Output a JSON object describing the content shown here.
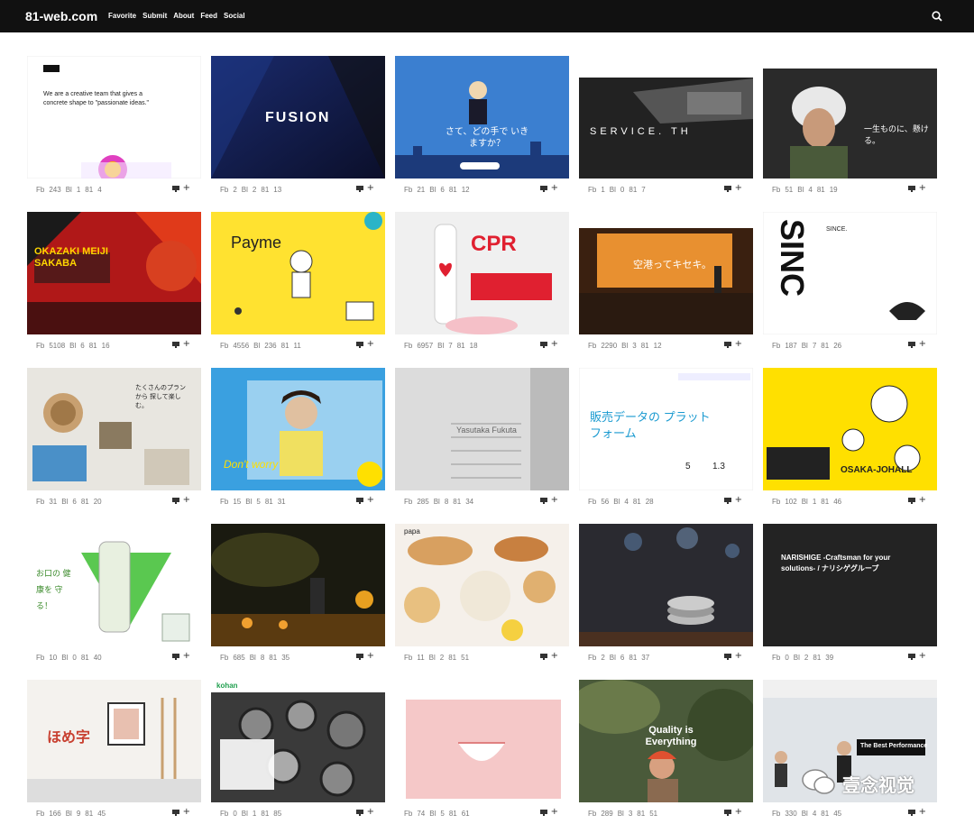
{
  "site": {
    "logo": "81-web.com"
  },
  "nav": [
    {
      "label": "Favorite"
    },
    {
      "label": "Submit"
    },
    {
      "label": "About"
    },
    {
      "label": "Feed"
    },
    {
      "label": "Social"
    }
  ],
  "watermark": "壹念视觉",
  "cards": [
    {
      "fb": "243",
      "bl": "1",
      "b1": "4",
      "text": "We are a creative team that gives a concrete shape to \"passionate ideas.\""
    },
    {
      "fb": "2",
      "bl": "2",
      "b1": "13",
      "text": "FUSION"
    },
    {
      "fb": "21",
      "bl": "6",
      "b1": "12",
      "text": "さて、どの手で いきますか？"
    },
    {
      "fb": "1",
      "bl": "0",
      "b1": "7",
      "text": "SERVICE. TH"
    },
    {
      "fb": "51",
      "bl": "4",
      "b1": "19",
      "text": "一生ものに、懸ける。"
    },
    {
      "fb": "5108",
      "bl": "6",
      "b1": "16",
      "text": "OKAZAKI MEIJI SAKABA"
    },
    {
      "fb": "4556",
      "bl": "236",
      "b1": "11",
      "text": "Payme"
    },
    {
      "fb": "6957",
      "bl": "7",
      "b1": "18",
      "text": "CPR"
    },
    {
      "fb": "2290",
      "bl": "3",
      "b1": "12",
      "text": "空港ってキセキ。"
    },
    {
      "fb": "187",
      "bl": "7",
      "b1": "26",
      "text": "SINCE."
    },
    {
      "fb": "31",
      "bl": "6",
      "b1": "20",
      "text": "たくさんのプランから 探して楽しむ。"
    },
    {
      "fb": "15",
      "bl": "5",
      "b1": "31",
      "text": "Don't worry"
    },
    {
      "fb": "285",
      "bl": "8",
      "b1": "34",
      "text": "Yasutaka Fukuta"
    },
    {
      "fb": "56",
      "bl": "4",
      "b1": "28",
      "text": "販売データの プラットフォーム"
    },
    {
      "fb": "102",
      "bl": "1",
      "b1": "46",
      "text": "OSAKA-JOHALL"
    },
    {
      "fb": "10",
      "bl": "0",
      "b1": "40",
      "text": "お口の 健康を 守る！"
    },
    {
      "fb": "685",
      "bl": "8",
      "b1": "35",
      "text": ""
    },
    {
      "fb": "11",
      "bl": "2",
      "b1": "51",
      "text": "papa"
    },
    {
      "fb": "2",
      "bl": "6",
      "b1": "37",
      "text": ""
    },
    {
      "fb": "0",
      "bl": "2",
      "b1": "39",
      "text": "NARISHIGE -Craftsman for your solutions- / ナリシゲグループ"
    },
    {
      "fb": "166",
      "bl": "9",
      "b1": "45",
      "text": "ほめ字"
    },
    {
      "fb": "0",
      "bl": "1",
      "b1": "85",
      "text": "kohan"
    },
    {
      "fb": "74",
      "bl": "5",
      "b1": "61",
      "text": ""
    },
    {
      "fb": "289",
      "bl": "3",
      "b1": "51",
      "text": "Quality is Everything"
    },
    {
      "fb": "330",
      "bl": "4",
      "b1": "45",
      "text": "The Best Performance"
    }
  ],
  "labels": {
    "fb": "Fb",
    "bl": "Bl",
    "b1": "81"
  }
}
